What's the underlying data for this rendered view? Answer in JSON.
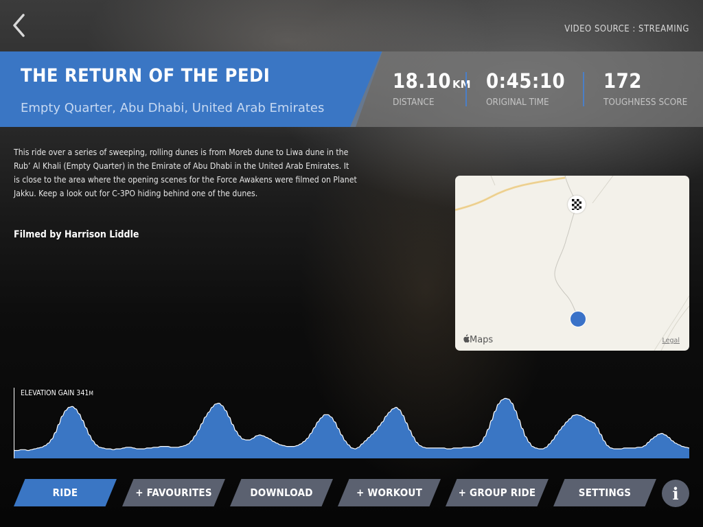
{
  "header": {
    "video_source": "VIDEO SOURCE : STREAMING"
  },
  "ride": {
    "title": "THE RETURN OF THE PEDI",
    "location": "Empty Quarter, Abu Dhabi, United Arab Emirates",
    "description": "This ride over a series of sweeping, rolling dunes is from Moreb dune to Liwa dune in the Rub’ Al Khali (Empty Quarter) in the Emirate of Abu Dhabi in the United Arab Emirates. It is close to the area where the opening scenes for the Force Awakens were filmed on Planet Jakku.  Keep a look out for C-3PO hiding behind one of the dunes.",
    "filmed_by": "Filmed by Harrison Liddle"
  },
  "stats": {
    "distance_value": "18.10",
    "distance_unit": "KM",
    "distance_label": "DISTANCE",
    "time_value": "0:45:10",
    "time_label": "ORIGINAL TIME",
    "score_value": "172",
    "score_label": "TOUGHNESS SCORE"
  },
  "map": {
    "brand": "Maps",
    "legal": "Legal",
    "start_color": "#3a72c8"
  },
  "elevation": {
    "label": "ELEVATION GAIN 341",
    "unit": "M",
    "fill_color": "#3a76c4",
    "profile": [
      8,
      8,
      9,
      9,
      8,
      9,
      10,
      11,
      12,
      14,
      17,
      22,
      30,
      40,
      50,
      57,
      61,
      62,
      59,
      53,
      45,
      36,
      27,
      20,
      15,
      12,
      11,
      10,
      10,
      9,
      10,
      10,
      11,
      12,
      12,
      11,
      10,
      10,
      10,
      11,
      11,
      12,
      12,
      13,
      13,
      13,
      12,
      12,
      12,
      13,
      14,
      16,
      20,
      26,
      33,
      41,
      49,
      55,
      61,
      65,
      66,
      63,
      57,
      49,
      40,
      32,
      26,
      22,
      21,
      21,
      23,
      26,
      27,
      26,
      24,
      22,
      19,
      17,
      15,
      14,
      13,
      13,
      13,
      14,
      16,
      19,
      23,
      29,
      36,
      43,
      48,
      52,
      52,
      49,
      43,
      35,
      27,
      20,
      15,
      11,
      10,
      12,
      16,
      20,
      24,
      28,
      32,
      38,
      43,
      50,
      55,
      59,
      61,
      58,
      51,
      42,
      33,
      25,
      18,
      14,
      12,
      11,
      11,
      11,
      11,
      11,
      11,
      10,
      10,
      11,
      11,
      11,
      12,
      12,
      12,
      13,
      14,
      18,
      25,
      34,
      45,
      56,
      65,
      70,
      72,
      71,
      66,
      57,
      46,
      35,
      25,
      18,
      13,
      11,
      10,
      10,
      12,
      16,
      21,
      27,
      33,
      38,
      43,
      47,
      51,
      52,
      51,
      49,
      46,
      44,
      42,
      36,
      28,
      20,
      14,
      11,
      10,
      10,
      10,
      11,
      11,
      11,
      11,
      12,
      12,
      14,
      18,
      22,
      25,
      28,
      29,
      27,
      24,
      20,
      17,
      15,
      13,
      12,
      11
    ]
  },
  "buttons": [
    {
      "label": "RIDE",
      "active": true
    },
    {
      "label": "+ FAVOURITES",
      "active": false
    },
    {
      "label": "DOWNLOAD",
      "active": false
    },
    {
      "label": "+ WORKOUT",
      "active": false
    },
    {
      "label": "+ GROUP RIDE",
      "active": false
    },
    {
      "label": "SETTINGS",
      "active": false
    }
  ],
  "info_label": "i",
  "icons": {
    "back": "chevron-left-icon",
    "info": "info-icon",
    "apple": "apple-icon",
    "finish": "checkered-flag-icon"
  },
  "colors": {
    "accent": "#3a76c4",
    "button": "#5b6170"
  }
}
